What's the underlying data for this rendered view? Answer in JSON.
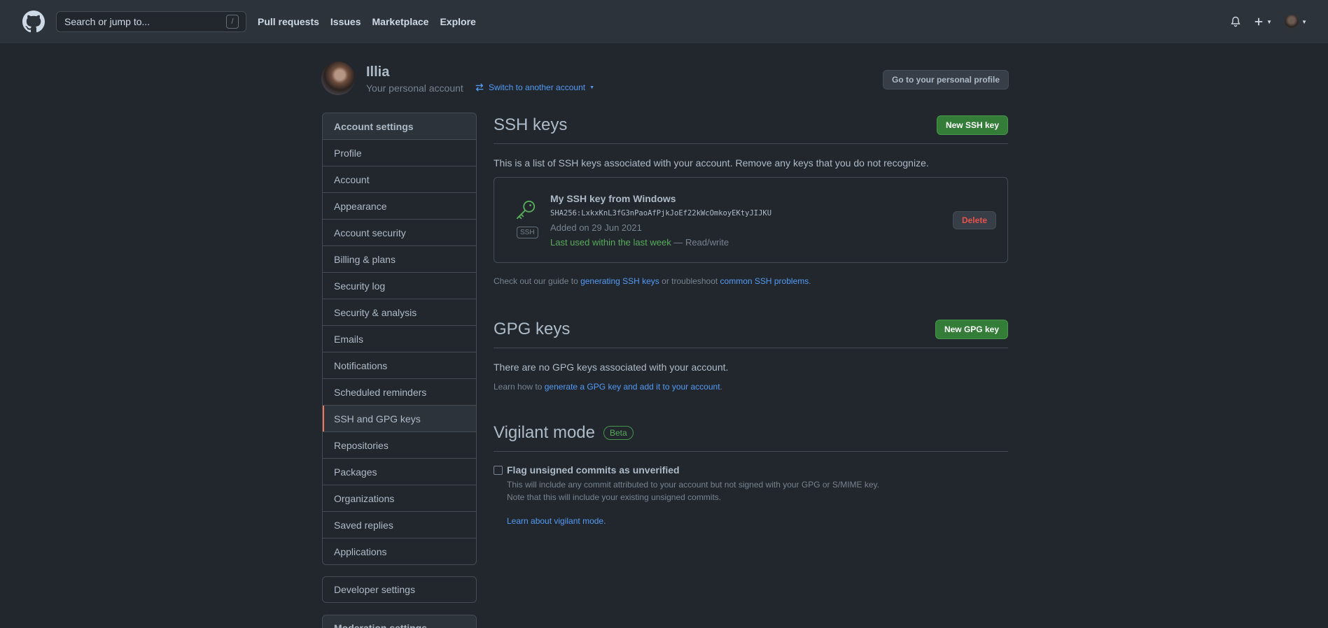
{
  "header": {
    "search_placeholder": "Search or jump to...",
    "search_shortcut": "/",
    "nav": [
      "Pull requests",
      "Issues",
      "Marketplace",
      "Explore"
    ],
    "icons": [
      "github-logo",
      "bell-icon",
      "plus-icon",
      "avatar"
    ]
  },
  "account": {
    "name": "Illia",
    "subtitle": "Your personal account",
    "switch_label": "Switch to another account",
    "profile_button": "Go to your personal profile"
  },
  "sidebar": {
    "heading": "Account settings",
    "items": [
      {
        "label": "Profile"
      },
      {
        "label": "Account"
      },
      {
        "label": "Appearance"
      },
      {
        "label": "Account security"
      },
      {
        "label": "Billing & plans"
      },
      {
        "label": "Security log"
      },
      {
        "label": "Security & analysis"
      },
      {
        "label": "Emails"
      },
      {
        "label": "Notifications"
      },
      {
        "label": "Scheduled reminders"
      },
      {
        "label": "SSH and GPG keys",
        "active": true
      },
      {
        "label": "Repositories"
      },
      {
        "label": "Packages"
      },
      {
        "label": "Organizations"
      },
      {
        "label": "Saved replies"
      },
      {
        "label": "Applications"
      }
    ],
    "developer_settings": "Developer settings",
    "moderation_settings": "Moderation settings"
  },
  "ssh": {
    "title": "SSH keys",
    "new_button": "New SSH key",
    "description": "This is a list of SSH keys associated with your account. Remove any keys that you do not recognize.",
    "key": {
      "badge": "SSH",
      "title": "My SSH key from Windows",
      "fingerprint": "SHA256:LxkxKnL3fG3nPaoAfPjkJoEf22kWcOmkoyEKtyJIJKU",
      "added": "Added on 29 Jun 2021",
      "last_used": "Last used within the last week",
      "access": " — Read/write",
      "delete_button": "Delete"
    },
    "guide_prefix": "Check out our guide to ",
    "guide_link1": "generating SSH keys",
    "guide_mid": " or troubleshoot ",
    "guide_link2": "common SSH problems",
    "guide_suffix": "."
  },
  "gpg": {
    "title": "GPG keys",
    "new_button": "New GPG key",
    "empty": "There are no GPG keys associated with your account.",
    "learn_prefix": "Learn how to ",
    "learn_link": "generate a GPG key and add it to your account",
    "learn_suffix": "."
  },
  "vigilant": {
    "title": "Vigilant mode",
    "badge": "Beta",
    "checkbox_label": "Flag unsigned commits as unverified",
    "checked": false,
    "note1": "This will include any commit attributed to your account but not signed with your GPG or S/MIME key.",
    "note2": "Note that this will include your existing unsigned commits.",
    "learn_link": "Learn about vigilant mode."
  },
  "colors": {
    "bg": "#22272e",
    "header_bg": "#2d333b",
    "accent_green": "#347d39",
    "link": "#539bf5",
    "danger": "#e5534b",
    "active_marker": "#ec775c"
  }
}
